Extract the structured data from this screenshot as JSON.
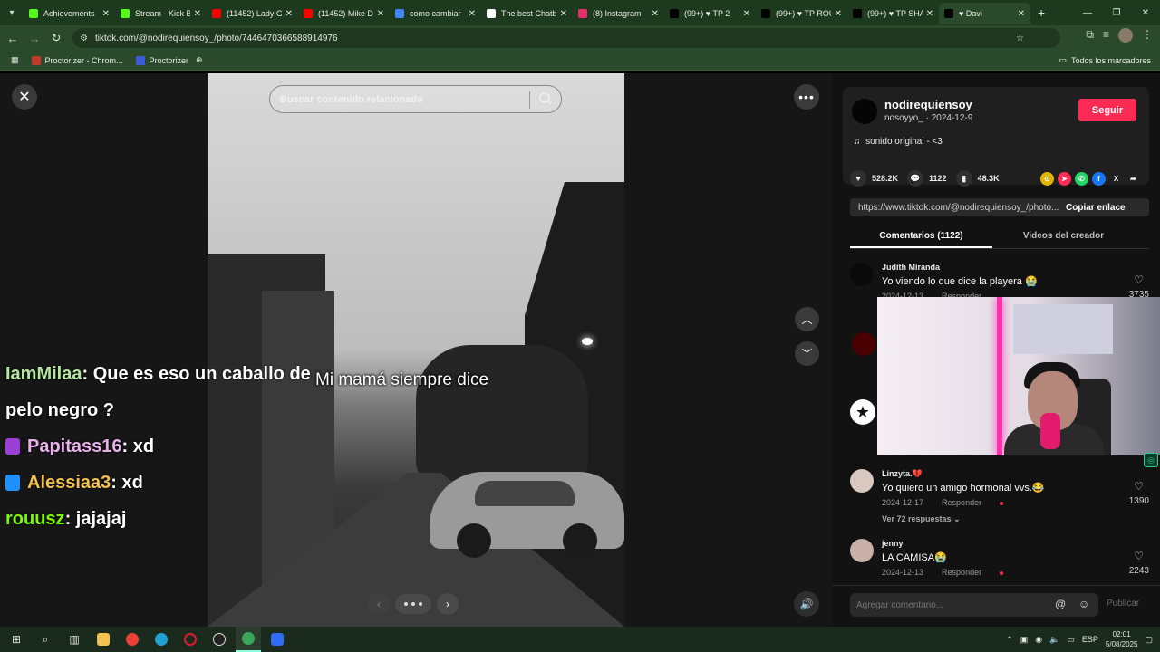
{
  "browser": {
    "tabs": [
      {
        "title": "Achievements",
        "color": "#53fc18",
        "active": false
      },
      {
        "title": "Stream - Kick B",
        "color": "#53fc18",
        "active": false
      },
      {
        "title": "(11452) Lady G",
        "color": "#ff0000",
        "active": false
      },
      {
        "title": "(11452) Mike D",
        "color": "#ff0000",
        "active": false
      },
      {
        "title": "como cambiar",
        "color": "#4285f4",
        "active": false
      },
      {
        "title": "The best Chatb",
        "color": "#ffffff",
        "active": false
      },
      {
        "title": "(8) Instagram",
        "color": "#e1306c",
        "active": false
      },
      {
        "title": "(99+) ♥ TP 2",
        "color": "#000000",
        "active": false
      },
      {
        "title": "(99+) ♥ TP ROU",
        "color": "#000000",
        "active": false
      },
      {
        "title": "(99+) ♥ TP SHA",
        "color": "#000000",
        "active": false
      },
      {
        "title": "♥ Davi",
        "color": "#000000",
        "active": true
      }
    ],
    "url": "tiktok.com/@nodirequiensoy_/photo/7446470366588914976",
    "bookmarks": [
      "Proctorizer - Chrom...",
      "Proctorizer"
    ],
    "all_bookmarks": "Todos los marcadores"
  },
  "viewer": {
    "search_placeholder": "Buscar contenido relacionado",
    "caption": "Mi mamá siempre dice"
  },
  "stream_chat": [
    {
      "user": "IamMilaa",
      "message": " : Que es eso un caballo de",
      "user_color": "#b6e6a0",
      "badge_color": ""
    },
    {
      "user": "",
      "message": "pelo negro ?",
      "user_color": "#ffffff",
      "badge_color": ""
    },
    {
      "user": "Papitass16",
      "message": " : xd",
      "user_color": "#e8b0e8",
      "badge_color": "#9b3fd6"
    },
    {
      "user": "Alessiaa3",
      "message": " : xd",
      "user_color": "#f2c14e",
      "badge_color": "#1e90ff"
    },
    {
      "user": "rouusz",
      "message": " : jajajaj",
      "user_color": "#7cfc00",
      "badge_color": ""
    }
  ],
  "post": {
    "username": "nodirequiensoy_",
    "subline": "nosoyyo_ · 2024-12-9",
    "follow_label": "Seguir",
    "sound": "sonido original - <3",
    "likes": "528.2K",
    "comments": "1122",
    "saves": "48.3K",
    "share_url": "https://www.tiktok.com/@nodirequiensoy_/photo...",
    "copy_label": "Copiar enlace",
    "tab_comments": "Comentarios (1122)",
    "tab_videos": "Videos del creador"
  },
  "comments": [
    {
      "name": "Judith Miranda",
      "text": "Yo viendo lo que dice la playera 😭",
      "date": "2024-12-13",
      "reply": "Responder",
      "likes": "3735"
    },
    {
      "name": "Linzyta.💔",
      "text": "Yo quiero un amigo hormonal vvs.😂",
      "date": "2024-12-17",
      "reply": "Responder",
      "likes": "1390"
    },
    {
      "name": "jenny",
      "text": "LA CAMISA😭",
      "date": "2024-12-13",
      "reply": "Responder",
      "likes": "2243"
    }
  ],
  "view_replies": "Ver 72 respuestas",
  "comment_box": {
    "placeholder": "Agregar comentario...",
    "post_label": "Publicar"
  },
  "taskbar": {
    "lang": "ESP",
    "time": "02:01",
    "date": "5/08/2025"
  }
}
